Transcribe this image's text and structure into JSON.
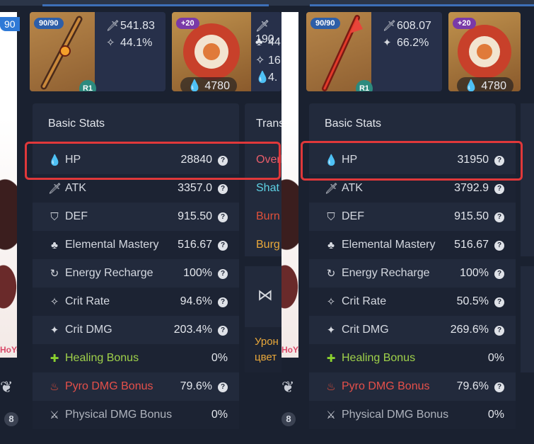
{
  "left_build": {
    "character": {
      "level_badge": "90",
      "brand": "HoYo",
      "constellation": "8"
    },
    "weapon": {
      "level": "90/90",
      "refinement": "R1",
      "atk": "541.83",
      "substat": "44.1%"
    },
    "artifact": {
      "level": "+20",
      "hp": "4780"
    },
    "artifact_side_values": [
      "190",
      "44",
      "16",
      "4."
    ],
    "stats_title": "Basic Stats",
    "stats": [
      {
        "label": "HP",
        "value": "28840",
        "help": "?"
      },
      {
        "label": "ATK",
        "value": "3357.0",
        "help": "?"
      },
      {
        "label": "DEF",
        "value": "915.50",
        "help": "?"
      },
      {
        "label": "Elemental Mastery",
        "value": "516.67",
        "help": "?"
      },
      {
        "label": "Energy Recharge",
        "value": "100%",
        "help": "?"
      },
      {
        "label": "Crit Rate",
        "value": "94.6%",
        "help": "?"
      },
      {
        "label": "Crit DMG",
        "value": "203.4%",
        "help": "?"
      },
      {
        "label": "Healing Bonus",
        "value": "0%",
        "help": ""
      },
      {
        "label": "Pyro DMG Bonus",
        "value": "79.6%",
        "help": "?"
      },
      {
        "label": "Physical DMG Bonus",
        "value": "0%",
        "help": ""
      }
    ]
  },
  "middle": {
    "title": "Trans",
    "reactions": [
      "Overl",
      "Shat",
      "Burn",
      "Burg"
    ],
    "ru_text": [
      "Урон",
      "цвет"
    ]
  },
  "right_build": {
    "character": {
      "brand": "HoYo",
      "constellation": "8"
    },
    "weapon": {
      "level": "90/90",
      "refinement": "R1",
      "atk": "608.07",
      "substat": "66.2%"
    },
    "artifact": {
      "level": "+20",
      "hp": "4780"
    },
    "stats_title": "Basic Stats",
    "stats": [
      {
        "label": "HP",
        "value": "31950",
        "help": "?"
      },
      {
        "label": "ATK",
        "value": "3792.9",
        "help": "?"
      },
      {
        "label": "DEF",
        "value": "915.50",
        "help": "?"
      },
      {
        "label": "Elemental Mastery",
        "value": "516.67",
        "help": "?"
      },
      {
        "label": "Energy Recharge",
        "value": "100%",
        "help": "?"
      },
      {
        "label": "Crit Rate",
        "value": "50.5%",
        "help": "?"
      },
      {
        "label": "Crit DMG",
        "value": "269.6%",
        "help": "?"
      },
      {
        "label": "Healing Bonus",
        "value": "0%",
        "help": ""
      },
      {
        "label": "Pyro DMG Bonus",
        "value": "79.6%",
        "help": "?"
      },
      {
        "label": "Physical DMG Bonus",
        "value": "0%",
        "help": ""
      }
    ]
  },
  "icons": [
    "hp-drop-icon",
    "sword-icon",
    "shield-icon",
    "mastery-icon",
    "recharge-icon",
    "crit-rate-icon",
    "crit-dmg-icon",
    "healing-cross-icon",
    "pyro-icon",
    "physical-icon",
    "butterfly-icon"
  ],
  "colors": {
    "highlight": "#e0383a",
    "healing": "#9fd14a",
    "pyro": "#e6504a",
    "overload": "#e85d6a",
    "shatter": "#5fd3e6",
    "burning": "#e0503a",
    "burgeon": "#e9a83a"
  }
}
